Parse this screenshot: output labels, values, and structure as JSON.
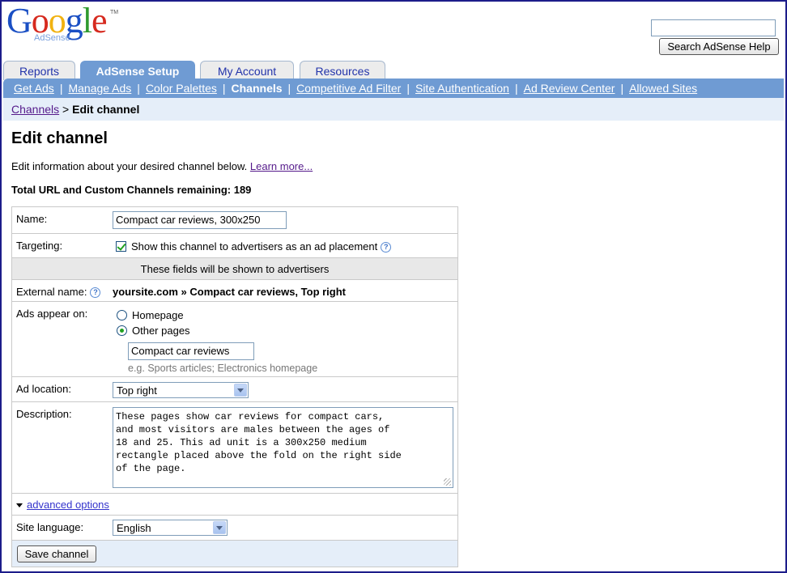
{
  "logo": {
    "word": [
      "G",
      "o",
      "o",
      "g",
      "l",
      "e"
    ],
    "sub": "AdSense",
    "tm": "TM"
  },
  "help_search": {
    "value": "",
    "button": "Search AdSense Help"
  },
  "tabs": [
    {
      "label": "Reports",
      "active": false
    },
    {
      "label": "AdSense Setup",
      "active": true
    },
    {
      "label": "My Account",
      "active": false
    },
    {
      "label": "Resources",
      "active": false
    }
  ],
  "subnav": [
    {
      "label": "Get Ads",
      "current": false
    },
    {
      "label": "Manage Ads",
      "current": false
    },
    {
      "label": "Color Palettes",
      "current": false
    },
    {
      "label": "Channels",
      "current": true
    },
    {
      "label": "Competitive Ad Filter",
      "current": false
    },
    {
      "label": "Site Authentication",
      "current": false
    },
    {
      "label": "Ad Review Center",
      "current": false
    },
    {
      "label": "Allowed Sites",
      "current": false
    }
  ],
  "breadcrumb": {
    "parent": "Channels",
    "separator": ">",
    "current": "Edit channel"
  },
  "page_title": "Edit channel",
  "intro": {
    "text": "Edit information about your desired channel below.",
    "link": "Learn more..."
  },
  "remaining": "Total URL and Custom Channels remaining: 189",
  "form": {
    "name_label": "Name:",
    "name_value": "Compact car reviews, 300x250",
    "targeting_label": "Targeting:",
    "targeting_text": "Show this channel to advertisers as an ad placement",
    "targeting_checked": true,
    "advertisers_header": "These fields will be shown to advertisers",
    "external_label": "External name:",
    "external_value": "yoursite.com » Compact car reviews, Top right",
    "appear_label": "Ads appear on:",
    "appear_homepage": "Homepage",
    "appear_other": "Other pages",
    "appear_selected": "Other pages",
    "pages_value": "Compact car reviews",
    "pages_hint": "e.g. Sports articles; Electronics homepage",
    "location_label": "Ad location:",
    "location_value": "Top right",
    "description_label": "Description:",
    "description_value": "These pages show car reviews for compact cars,\nand most visitors are males between the ages of\n18 and 25. This ad unit is a 300x250 medium\nrectangle placed above the fold on the right side\nof the page.",
    "advanced_link": "advanced options",
    "language_label": "Site language:",
    "language_value": "English",
    "save_button": "Save channel"
  },
  "colors": {
    "accent": "#6f9bd3",
    "crumb_bg": "#e5eef9",
    "link": "#3333cc",
    "check": "#21a121"
  },
  "icons": {
    "help": "help-question-icon",
    "dropdown": "chevron-down-icon",
    "expand": "triangle-down-icon"
  }
}
